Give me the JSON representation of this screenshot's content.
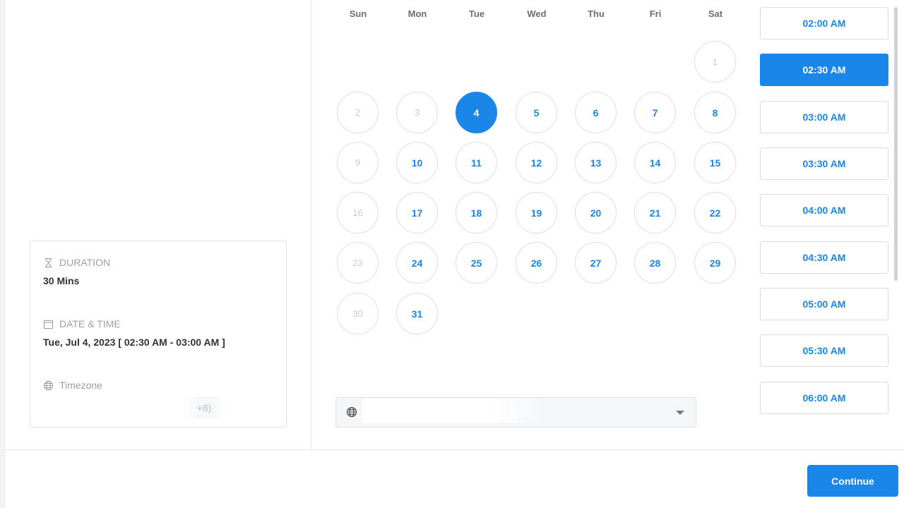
{
  "summary": {
    "duration_label": "DURATION",
    "duration_value": "30 Mins",
    "datetime_label": "DATE & TIME",
    "datetime_value": "Tue, Jul 4, 2023 [ 02:30 AM - 03:00 AM ]",
    "timezone_label": "Timezone",
    "timezone_value": "+8)"
  },
  "calendar": {
    "weekdays": [
      "Sun",
      "Mon",
      "Tue",
      "Wed",
      "Thu",
      "Fri",
      "Sat"
    ],
    "weeks": [
      [
        "",
        "",
        "",
        "",
        "",
        "",
        "1"
      ],
      [
        "2",
        "3",
        "4",
        "5",
        "6",
        "7",
        "8"
      ],
      [
        "9",
        "10",
        "11",
        "12",
        "13",
        "14",
        "15"
      ],
      [
        "16",
        "17",
        "18",
        "19",
        "20",
        "21",
        "22"
      ],
      [
        "23",
        "24",
        "25",
        "26",
        "27",
        "28",
        "29"
      ],
      [
        "30",
        "31",
        "",
        "",
        "",
        "",
        ""
      ]
    ],
    "disabled_days": [
      "1",
      "2",
      "3",
      "9",
      "16",
      "23",
      "30"
    ],
    "selected_day": "4"
  },
  "timezone_select": {
    "value": "",
    "icon": "globe-icon"
  },
  "time_slots": [
    "02:00 AM",
    "02:30 AM",
    "03:00 AM",
    "03:30 AM",
    "04:00 AM",
    "04:30 AM",
    "05:00 AM",
    "05:30 AM",
    "06:00 AM"
  ],
  "selected_slot": "02:30 AM",
  "continue_label": "Continue",
  "colors": {
    "accent": "#1a86e8",
    "disabled_text": "#c8ccd1",
    "border": "#dcdfe3"
  }
}
